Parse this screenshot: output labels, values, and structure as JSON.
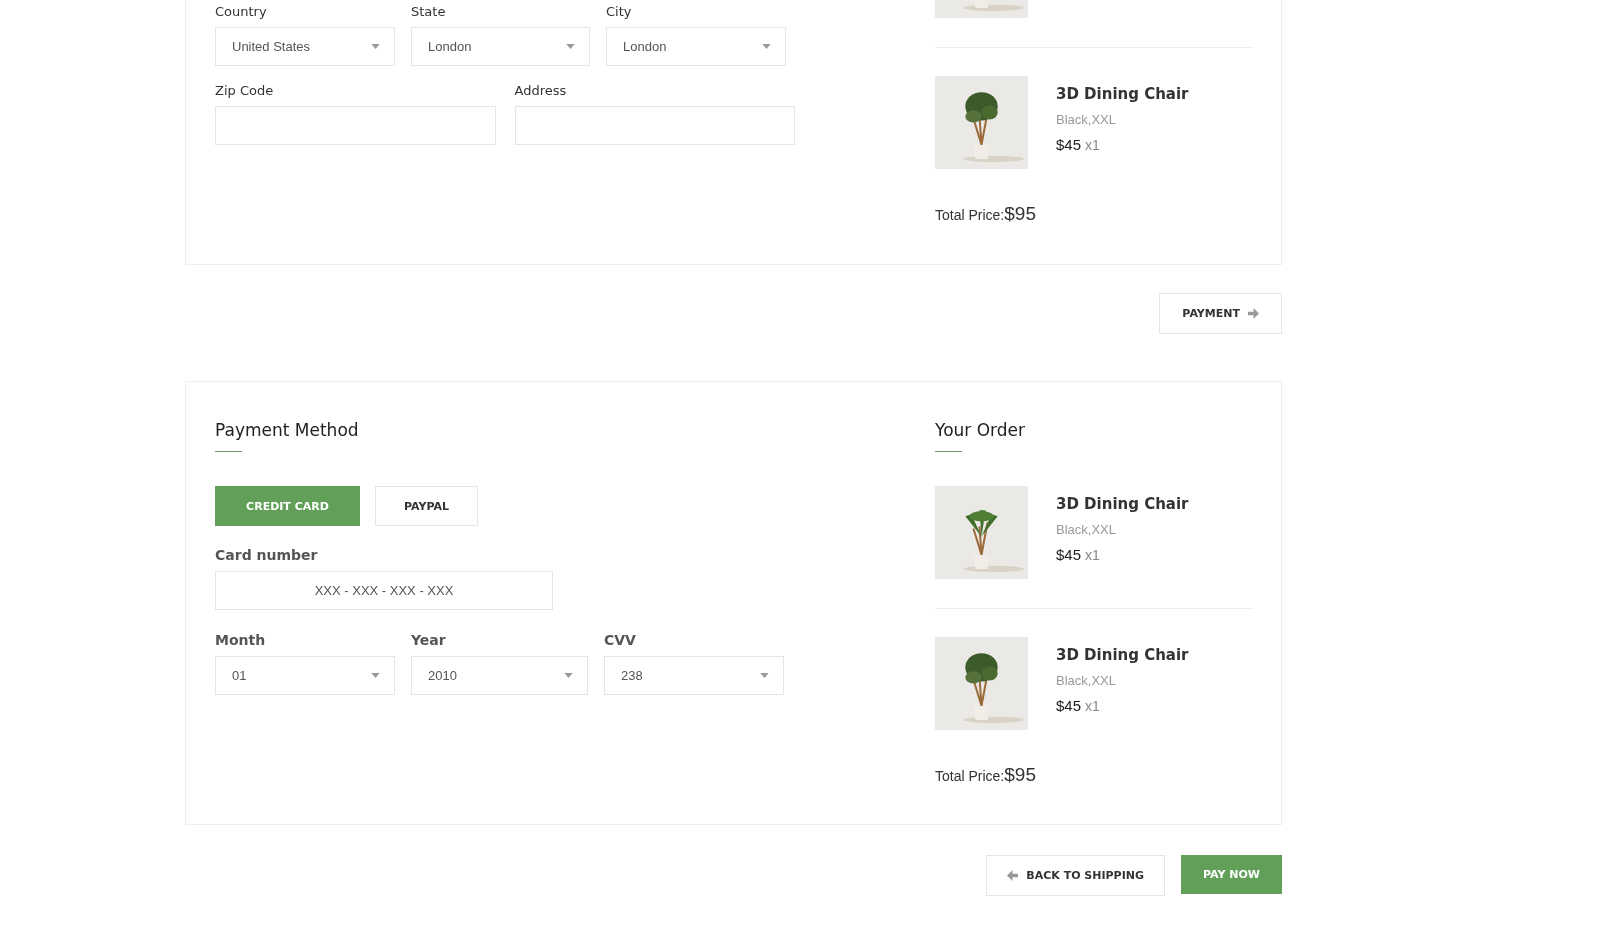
{
  "shipping": {
    "rows": [
      [
        {
          "label": "Country",
          "kind": "select",
          "value": "United States"
        },
        {
          "label": "State",
          "kind": "select",
          "value": "London"
        },
        {
          "label": "City",
          "kind": "select",
          "value": "London"
        }
      ],
      [
        {
          "label": "Zip Code",
          "kind": "text"
        },
        {
          "label": "Address",
          "kind": "text"
        }
      ]
    ],
    "order": {
      "items": [
        {
          "name": "3D Dining Chair",
          "variant": "Black,XXL",
          "price": "$45",
          "qty": "x1"
        }
      ],
      "total_label": "Total Price:",
      "total_value": "$95"
    }
  },
  "next_button": "PAYMENT",
  "payment": {
    "title": "Payment Method",
    "methods": [
      {
        "label": "CREDIT CARD",
        "selected": true
      },
      {
        "label": "PAYPAL",
        "selected": false
      }
    ],
    "card_number": {
      "label": "Card number",
      "placeholder": "XXX - XXX - XXX - XXX"
    },
    "selects": [
      {
        "label": "Month",
        "value": "01"
      },
      {
        "label": "Year",
        "value": "2010"
      },
      {
        "label": "CVV",
        "value": "238"
      }
    ],
    "order": {
      "title": "Your Order",
      "items": [
        {
          "name": "3D Dining Chair",
          "variant": "Black,XXL",
          "price": "$45",
          "qty": "x1"
        },
        {
          "name": "3D Dining Chair",
          "variant": "Black,XXL",
          "price": "$45",
          "qty": "x1"
        }
      ],
      "total_label": "Total Price:",
      "total_value": "$95"
    }
  },
  "actions": [
    {
      "label": "BACK TO SHIPPING",
      "kind": "back"
    },
    {
      "label": "PAY NOW",
      "kind": "primary"
    }
  ]
}
